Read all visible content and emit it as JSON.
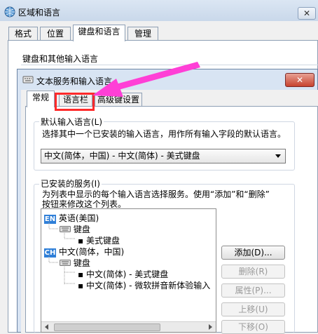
{
  "outer": {
    "title": "区域和语言",
    "close": "✕",
    "tabs": [
      "格式",
      "位置",
      "键盘和语言",
      "管理"
    ],
    "group_title": "键盘和其他输入语言"
  },
  "dialog": {
    "title": "文本服务和输入语言",
    "close": "✕",
    "tabs": [
      "常规",
      "语言栏",
      "高级键设置"
    ],
    "default_group": {
      "title": "默认输入语言(L)",
      "desc": "选择其中一个已安装的输入语言，用作所有输入字段的默认语言。",
      "selected": "中文(简体，中国) - 中文(简体) - 美式键盘"
    },
    "services_group": {
      "title": "已安装的服务(I)",
      "desc_line1": "为列表中显示的每个输入语言选择服务。使用“添加”和“删除”",
      "desc_line2": "按钮来修改这个列表。",
      "tree": {
        "lang1_badge": "EN",
        "lang1": "英语(美国)",
        "kbd1": "键盘",
        "kbd1_item": "美式键盘",
        "lang2_badge": "CH",
        "lang2": "中文(简体，中国)",
        "kbd2": "键盘",
        "kbd2_item1": "中文(简体) - 美式键盘",
        "kbd2_item2": "中文(简体) - 微软拼音新体验输入"
      },
      "buttons": {
        "add": "添加(D)...",
        "remove": "删除(R)",
        "properties": "属性(P)...",
        "move_up": "上移(U)",
        "move_down": "下移(O)"
      }
    }
  },
  "colors": {
    "annotation": "#ff2a2a",
    "badge": "#2f7fd8"
  }
}
